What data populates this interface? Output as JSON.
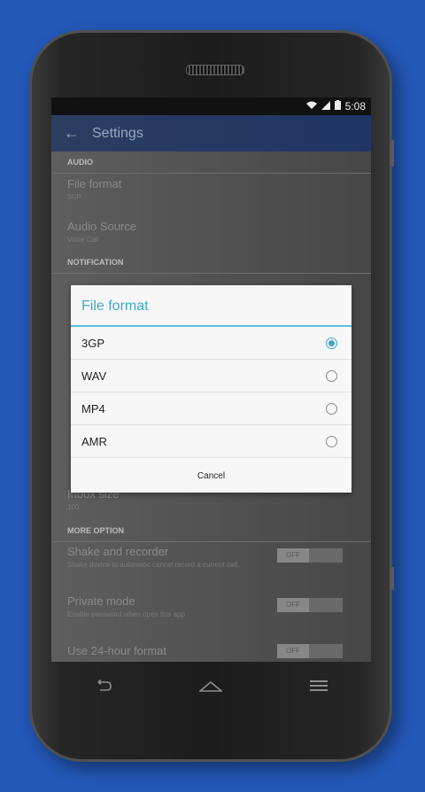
{
  "status_bar": {
    "time": "5:08"
  },
  "app_bar": {
    "title": "Settings"
  },
  "settings": {
    "audio_header": "AUDIO",
    "file_format": {
      "title": "File format",
      "summary": "3GP"
    },
    "audio_source": {
      "title": "Audio Source",
      "summary": "Voice Call"
    },
    "notification_header": "NOTIFICATION",
    "inbox_size": {
      "title": "Inbox size",
      "summary": "100"
    },
    "more_option_header": "MORE OPTION",
    "shake": {
      "title": "Shake and recorder",
      "summary": "Shake device to automatic cancel record a current call.",
      "toggle": "OFF"
    },
    "private_mode": {
      "title": "Private mode",
      "summary": "Enable password when open this app",
      "toggle": "OFF"
    },
    "hour_format": {
      "title": "Use 24-hour format",
      "toggle": "OFF"
    }
  },
  "dialog": {
    "title": "File format",
    "options": [
      {
        "label": "3GP",
        "selected": true
      },
      {
        "label": "WAV",
        "selected": false
      },
      {
        "label": "MP4",
        "selected": false
      },
      {
        "label": "AMR",
        "selected": false
      }
    ],
    "cancel_label": "Cancel"
  },
  "nav_bar": {
    "back_icon": "back-icon",
    "home_icon": "home-icon",
    "menu_icon": "menu-icon"
  },
  "colors": {
    "accent": "#3fa9c9",
    "background": "#2358b8",
    "app_bar": "#1f3566"
  }
}
